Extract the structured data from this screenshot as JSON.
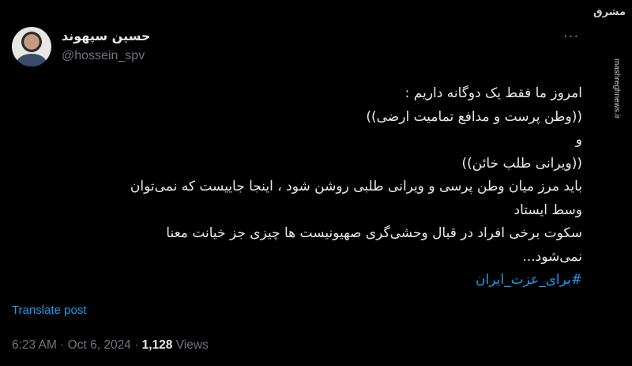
{
  "author": {
    "display_name": "حسین سپهوند",
    "handle": "@hossein_spv"
  },
  "menu": {
    "more_glyph": "···"
  },
  "watermark": {
    "logo_text": "مشرق",
    "url": "mashreghnews.ir"
  },
  "post": {
    "lines": [
      "امروز ما فقط یک دوگانه داریم :",
      "((وطن پرست و مدافع تمامیت ارضی))",
      "و",
      "((ویرانی طلب خائن))",
      "باید مرز میان وطن پرسی و ویرانی طلبی روشن شود ، اینجا جاییست که نمی‌توان",
      "وسط ایستاد",
      "سکوت برخی افراد در قبال وحشی‌گری صهیونیست ها چیزی جز خیانت معنا",
      "نمی‌شود..."
    ],
    "hashtag": "#برای_عزت_ایران"
  },
  "actions": {
    "translate_label": "Translate post"
  },
  "meta": {
    "time": "6:23 AM",
    "separator": "·",
    "date": "Oct 6, 2024",
    "views_count": "1,128",
    "views_label": "Views"
  },
  "colors": {
    "background": "#000000",
    "text": "#e7e9ea",
    "muted": "#71767b",
    "accent": "#1d9bf0"
  }
}
